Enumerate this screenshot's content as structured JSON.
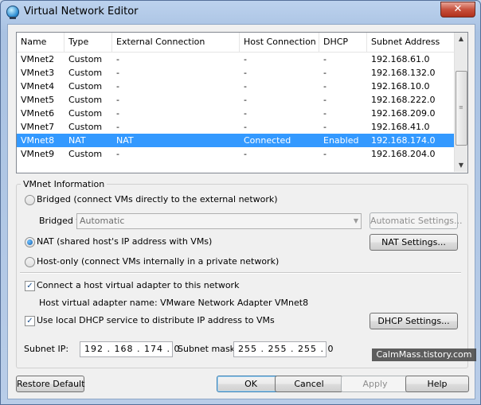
{
  "window": {
    "title": "Virtual Network Editor",
    "close_glyph": "✕"
  },
  "list": {
    "columns": [
      "Name",
      "Type",
      "External Connection",
      "Host Connection",
      "DHCP",
      "Subnet Address"
    ],
    "rows": [
      {
        "name": "VMnet2",
        "type": "Custom",
        "external": "-",
        "host": "-",
        "dhcp": "-",
        "subnet": "192.168.61.0",
        "selected": false
      },
      {
        "name": "VMnet3",
        "type": "Custom",
        "external": "-",
        "host": "-",
        "dhcp": "-",
        "subnet": "192.168.132.0",
        "selected": false
      },
      {
        "name": "VMnet4",
        "type": "Custom",
        "external": "-",
        "host": "-",
        "dhcp": "-",
        "subnet": "192.168.10.0",
        "selected": false
      },
      {
        "name": "VMnet5",
        "type": "Custom",
        "external": "-",
        "host": "-",
        "dhcp": "-",
        "subnet": "192.168.222.0",
        "selected": false
      },
      {
        "name": "VMnet6",
        "type": "Custom",
        "external": "-",
        "host": "-",
        "dhcp": "-",
        "subnet": "192.168.209.0",
        "selected": false
      },
      {
        "name": "VMnet7",
        "type": "Custom",
        "external": "-",
        "host": "-",
        "dhcp": "-",
        "subnet": "192.168.41.0",
        "selected": false
      },
      {
        "name": "VMnet8",
        "type": "NAT",
        "external": "NAT",
        "host": "Connected",
        "dhcp": "Enabled",
        "subnet": "192.168.174.0",
        "selected": true
      },
      {
        "name": "VMnet9",
        "type": "Custom",
        "external": "-",
        "host": "-",
        "dhcp": "-",
        "subnet": "192.168.204.0",
        "selected": false
      }
    ],
    "scroll_up_glyph": "▲",
    "scroll_down_glyph": "▼"
  },
  "vmnet_info": {
    "group_label": "VMnet Information",
    "bridged_label": "Bridged (connect VMs directly to the external network)",
    "bridged_to_label": "Bridged to:",
    "bridged_to_value": "Automatic",
    "automatic_settings_label": "Automatic Settings...",
    "nat_label": "NAT (shared host's IP address with VMs)",
    "nat_settings_label": "NAT Settings...",
    "hostonly_label": "Host-only (connect VMs internally in a private network)",
    "mode_selected": "nat",
    "connect_adapter_label": "Connect a host virtual adapter to this network",
    "connect_adapter_checked": true,
    "adapter_name_text": "Host virtual adapter name: VMware Network Adapter VMnet8",
    "dhcp_label": "Use local DHCP service to distribute IP address to VMs",
    "dhcp_checked": true,
    "dhcp_settings_label": "DHCP Settings...",
    "subnet_ip_label": "Subnet IP:",
    "subnet_ip_value": "192 . 168 . 174 .  0",
    "subnet_mask_label": "Subnet mask:",
    "subnet_mask_value": "255 . 255 . 255 .  0",
    "check_glyph": "✓"
  },
  "footer": {
    "restore_default_label": "Restore Default",
    "ok_label": "OK",
    "cancel_label": "Cancel",
    "apply_label": "Apply",
    "help_label": "Help"
  },
  "watermark": "CalmMass.tistory.com"
}
